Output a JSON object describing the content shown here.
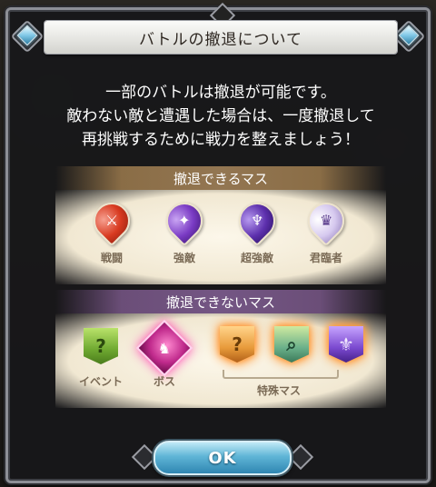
{
  "dialog": {
    "title": "バトルの撤退について",
    "description": [
      "一部のバトルは撤退が可能です。",
      "敵わない敵と遭遇した場合は、一度撤退して",
      "再挑戦するために戦力を整えましょう！"
    ],
    "retreat_possible": {
      "header": "撤退できるマス",
      "items": [
        {
          "label": "戦闘",
          "icon": "sword-icon",
          "color": "#d83a20"
        },
        {
          "label": "強敵",
          "icon": "beast-icon",
          "color": "#7a3bc4"
        },
        {
          "label": "超強敵",
          "icon": "dragon-icon",
          "color": "#5d30ad"
        },
        {
          "label": "君臨者",
          "icon": "demon-icon",
          "color": "#d6c9ef"
        }
      ]
    },
    "retreat_impossible": {
      "header": "撤退できないマス",
      "items": [
        {
          "label": "イベント",
          "icon": "question-icon",
          "color": "#6ea830"
        },
        {
          "label": "ボス",
          "icon": "boss-icon",
          "color": "#c02a8c"
        },
        {
          "icon": "question-icon",
          "color": "#e79a3a"
        },
        {
          "icon": "search-scroll-icon",
          "color": "#6ab08a"
        },
        {
          "icon": "crest-icon",
          "color": "#7a49cf"
        }
      ],
      "special_label": "特殊マス"
    },
    "ok_button": "OK"
  }
}
